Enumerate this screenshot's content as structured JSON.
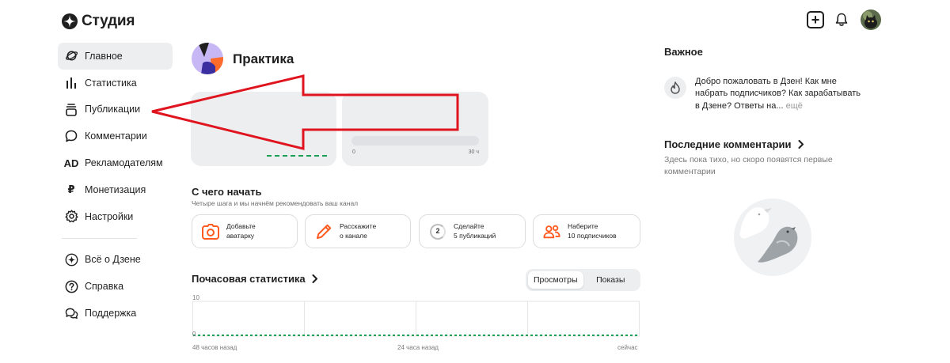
{
  "header": {
    "logo_text": "Студия",
    "add_icon": "plus-square-icon",
    "bell_icon": "bell-icon"
  },
  "sidebar": {
    "items": [
      {
        "label": "Главное",
        "icon": "planet-icon",
        "active": true
      },
      {
        "label": "Статистика",
        "icon": "bar-chart-icon"
      },
      {
        "label": "Публикации",
        "icon": "stack-icon"
      },
      {
        "label": "Комментарии",
        "icon": "speech-bubble-icon"
      },
      {
        "label": "Рекламодателям",
        "icon": "ad-icon",
        "glyph": "AD"
      },
      {
        "label": "Монетизация",
        "icon": "ruble-icon",
        "glyph": "₽"
      },
      {
        "label": "Настройки",
        "icon": "gear-icon"
      }
    ],
    "footer_items": [
      {
        "label": "Всё о Дзене",
        "icon": "zen-star-icon"
      },
      {
        "label": "Справка",
        "icon": "question-icon"
      },
      {
        "label": "Поддержка",
        "icon": "chat-icon"
      }
    ]
  },
  "main": {
    "channel_name": "Практика",
    "card2": {
      "axis_start": "0",
      "axis_end": "30 ч"
    },
    "start": {
      "title": "С чего начать",
      "subtitle": "Четыре шага и мы начнём рекомендовать ваш канал",
      "steps": [
        {
          "line1": "Добавьте",
          "line2": "аватарку",
          "icon": "camera-icon"
        },
        {
          "line1": "Расскажите",
          "line2": "о канале",
          "icon": "pencil-icon"
        },
        {
          "line1": "Сделайте",
          "line2": "5 публикаций",
          "icon": "progress-ring-icon",
          "number": "2"
        },
        {
          "line1": "Наберите",
          "line2": "10 подписчиков",
          "icon": "users-icon"
        }
      ]
    },
    "hourly": {
      "title": "Почасовая статистика",
      "toggle": [
        "Просмотры",
        "Показы"
      ],
      "active_toggle": "Просмотры"
    }
  },
  "chart_data": {
    "type": "line",
    "title": "Почасовая статистика",
    "x_tick_labels": [
      "48 часов назад",
      "24 часа назад",
      "сейчас"
    ],
    "y_tick_labels": [
      "10",
      "0"
    ],
    "ylim": [
      0,
      10
    ],
    "series": [
      {
        "values": [
          0,
          0,
          0,
          0,
          0,
          0,
          0,
          0,
          0,
          0,
          0,
          0,
          0,
          0,
          0,
          0,
          0,
          0,
          0,
          0,
          0,
          0,
          0,
          0,
          0,
          0,
          0,
          0,
          0,
          0,
          0,
          0,
          0,
          0,
          0,
          0,
          0,
          0,
          0,
          0,
          0,
          0,
          0,
          0,
          0,
          0,
          0,
          0
        ]
      }
    ],
    "grid": true,
    "color": "#1a9f55"
  },
  "right": {
    "important_title": "Важное",
    "news": {
      "text": "Добро пожаловать в Дзен! Как мне набрать подписчиков? Как зарабатывать в Дзене? Ответы на...",
      "more": "ещё",
      "icon": "flame-icon"
    },
    "comments_title": "Последние комментарии",
    "comments_empty": "Здесь пока тихо, но скоро появятся первые комментарии"
  },
  "colors": {
    "accent_orange": "#ff5a1f",
    "arrow_red": "#e0141e",
    "channel_avatar_purple": "#c7b8f5",
    "chart_green": "#1a9f55"
  }
}
